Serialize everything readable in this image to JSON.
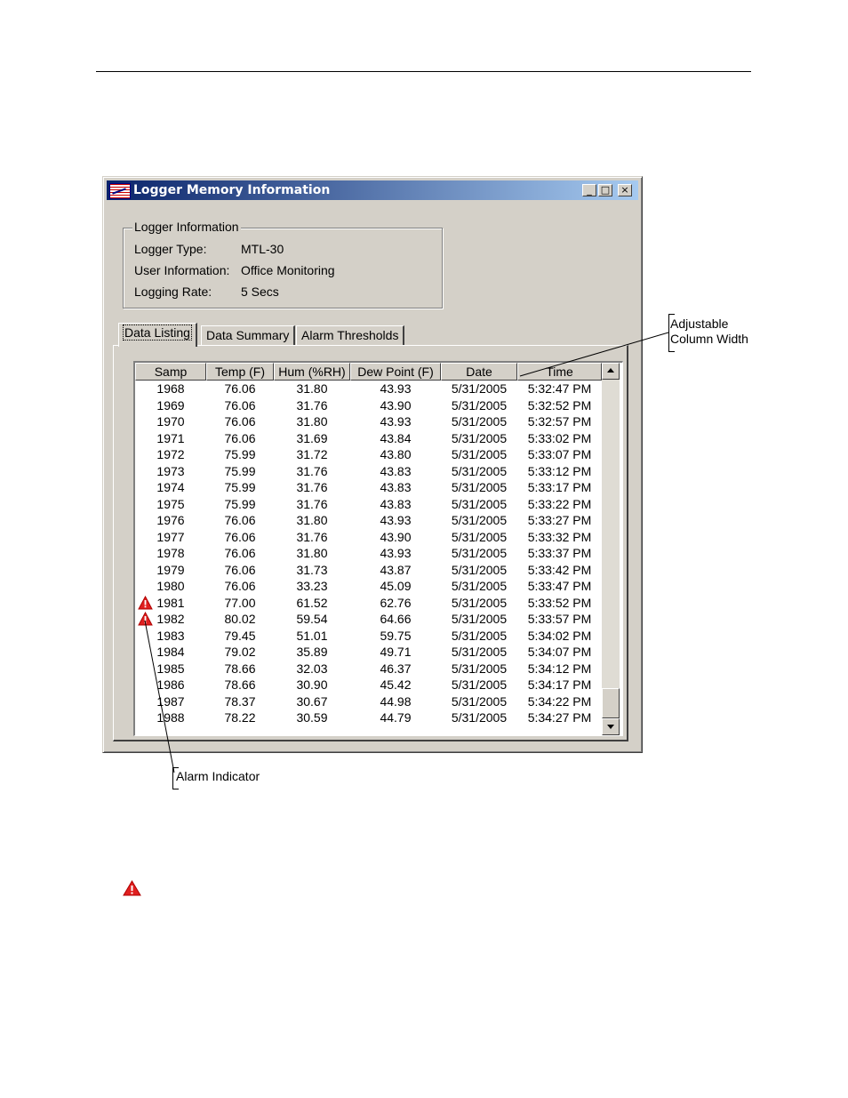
{
  "window": {
    "title": "Logger Memory Information",
    "minimize": "_",
    "maximize": "□",
    "close": "×"
  },
  "logger_info": {
    "group_title": "Logger Information",
    "fields": [
      {
        "label": "Logger Type:",
        "value": "MTL-30"
      },
      {
        "label": "User Information:",
        "value": "Office Monitoring"
      },
      {
        "label": "Logging Rate:",
        "value": "5 Secs"
      }
    ]
  },
  "tabs": [
    {
      "label": "Data Listing",
      "active": true
    },
    {
      "label": "Data Summary",
      "active": false
    },
    {
      "label": "Alarm Thresholds",
      "active": false
    }
  ],
  "table": {
    "columns": [
      "Samp",
      "Temp (F)",
      "Hum (%RH)",
      "Dew Point (F)",
      "Date",
      "Time"
    ],
    "rows": [
      {
        "alarm": false,
        "cells": [
          "1968",
          "76.06",
          "31.80",
          "43.93",
          "5/31/2005",
          "5:32:47 PM"
        ]
      },
      {
        "alarm": false,
        "cells": [
          "1969",
          "76.06",
          "31.76",
          "43.90",
          "5/31/2005",
          "5:32:52 PM"
        ]
      },
      {
        "alarm": false,
        "cells": [
          "1970",
          "76.06",
          "31.80",
          "43.93",
          "5/31/2005",
          "5:32:57 PM"
        ]
      },
      {
        "alarm": false,
        "cells": [
          "1971",
          "76.06",
          "31.69",
          "43.84",
          "5/31/2005",
          "5:33:02 PM"
        ]
      },
      {
        "alarm": false,
        "cells": [
          "1972",
          "75.99",
          "31.72",
          "43.80",
          "5/31/2005",
          "5:33:07 PM"
        ]
      },
      {
        "alarm": false,
        "cells": [
          "1973",
          "75.99",
          "31.76",
          "43.83",
          "5/31/2005",
          "5:33:12 PM"
        ]
      },
      {
        "alarm": false,
        "cells": [
          "1974",
          "75.99",
          "31.76",
          "43.83",
          "5/31/2005",
          "5:33:17 PM"
        ]
      },
      {
        "alarm": false,
        "cells": [
          "1975",
          "75.99",
          "31.76",
          "43.83",
          "5/31/2005",
          "5:33:22 PM"
        ]
      },
      {
        "alarm": false,
        "cells": [
          "1976",
          "76.06",
          "31.80",
          "43.93",
          "5/31/2005",
          "5:33:27 PM"
        ]
      },
      {
        "alarm": false,
        "cells": [
          "1977",
          "76.06",
          "31.76",
          "43.90",
          "5/31/2005",
          "5:33:32 PM"
        ]
      },
      {
        "alarm": false,
        "cells": [
          "1978",
          "76.06",
          "31.80",
          "43.93",
          "5/31/2005",
          "5:33:37 PM"
        ]
      },
      {
        "alarm": false,
        "cells": [
          "1979",
          "76.06",
          "31.73",
          "43.87",
          "5/31/2005",
          "5:33:42 PM"
        ]
      },
      {
        "alarm": false,
        "cells": [
          "1980",
          "76.06",
          "33.23",
          "45.09",
          "5/31/2005",
          "5:33:47 PM"
        ]
      },
      {
        "alarm": true,
        "cells": [
          "1981",
          "77.00",
          "61.52",
          "62.76",
          "5/31/2005",
          "5:33:52 PM"
        ]
      },
      {
        "alarm": true,
        "cells": [
          "1982",
          "80.02",
          "59.54",
          "64.66",
          "5/31/2005",
          "5:33:57 PM"
        ]
      },
      {
        "alarm": false,
        "cells": [
          "1983",
          "79.45",
          "51.01",
          "59.75",
          "5/31/2005",
          "5:34:02 PM"
        ]
      },
      {
        "alarm": false,
        "cells": [
          "1984",
          "79.02",
          "35.89",
          "49.71",
          "5/31/2005",
          "5:34:07 PM"
        ]
      },
      {
        "alarm": false,
        "cells": [
          "1985",
          "78.66",
          "32.03",
          "46.37",
          "5/31/2005",
          "5:34:12 PM"
        ]
      },
      {
        "alarm": false,
        "cells": [
          "1986",
          "78.66",
          "30.90",
          "45.42",
          "5/31/2005",
          "5:34:17 PM"
        ]
      },
      {
        "alarm": false,
        "cells": [
          "1987",
          "78.37",
          "30.67",
          "44.98",
          "5/31/2005",
          "5:34:22 PM"
        ]
      },
      {
        "alarm": false,
        "cells": [
          "1988",
          "78.22",
          "30.59",
          "44.79",
          "5/31/2005",
          "5:34:27 PM"
        ]
      }
    ]
  },
  "callouts": {
    "column_width_line1": "Adjustable",
    "column_width_line2": "Column Width",
    "alarm_indicator": "Alarm Indicator"
  },
  "colors": {
    "alarm_red": "#e02020",
    "title_start": "#0a246a",
    "title_end": "#a6caf0",
    "window_face": "#d4d0c8"
  },
  "icons": {
    "alarm": "warning-triangle-icon",
    "app": "logger-app-icon"
  }
}
